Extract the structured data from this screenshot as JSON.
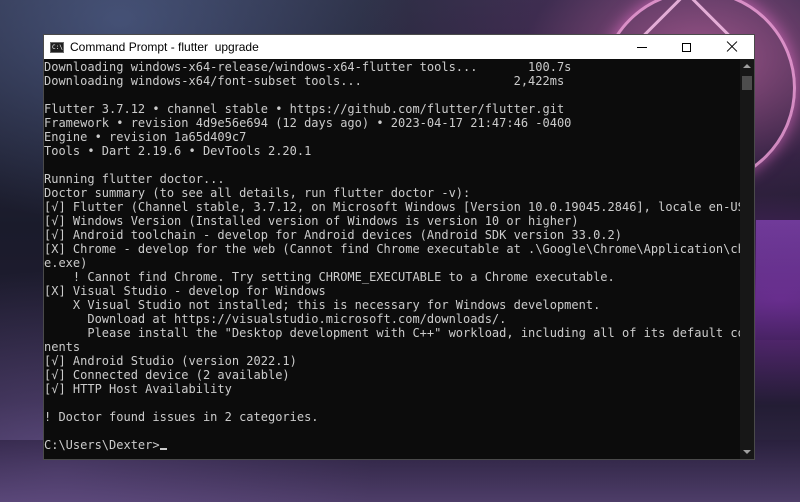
{
  "window": {
    "title": "Command Prompt - flutter  upgrade",
    "icon_text": "C:\\",
    "controls": [
      "minimize-icon",
      "maximize-icon",
      "close-icon"
    ]
  },
  "console": {
    "lines": [
      "Downloading windows-x64-release/windows-x64-flutter tools...       100.7s",
      "Downloading windows-x64/font-subset tools...                     2,422ms",
      "",
      "Flutter 3.7.12 • channel stable • https://github.com/flutter/flutter.git",
      "Framework • revision 4d9e56e694 (12 days ago) • 2023-04-17 21:47:46 -0400",
      "Engine • revision 1a65d409c7",
      "Tools • Dart 2.19.6 • DevTools 2.20.1",
      "",
      "Running flutter doctor...",
      "Doctor summary (to see all details, run flutter doctor -v):",
      "[√] Flutter (Channel stable, 3.7.12, on Microsoft Windows [Version 10.0.19045.2846], locale en-US)",
      "[√] Windows Version (Installed version of Windows is version 10 or higher)",
      "[√] Android toolchain - develop for Android devices (Android SDK version 33.0.2)",
      "[X] Chrome - develop for the web (Cannot find Chrome executable at .\\Google\\Chrome\\Application\\chrom",
      "e.exe)",
      "    ! Cannot find Chrome. Try setting CHROME_EXECUTABLE to a Chrome executable.",
      "[X] Visual Studio - develop for Windows",
      "    X Visual Studio not installed; this is necessary for Windows development.",
      "      Download at https://visualstudio.microsoft.com/downloads/.",
      "      Please install the \"Desktop development with C++\" workload, including all of its default compo",
      "nents",
      "[√] Android Studio (version 2022.1)",
      "[√] Connected device (2 available)",
      "[√] HTTP Host Availability",
      "",
      "! Doctor found issues in 2 categories.",
      "",
      "C:\\Users\\Dexter>"
    ]
  }
}
